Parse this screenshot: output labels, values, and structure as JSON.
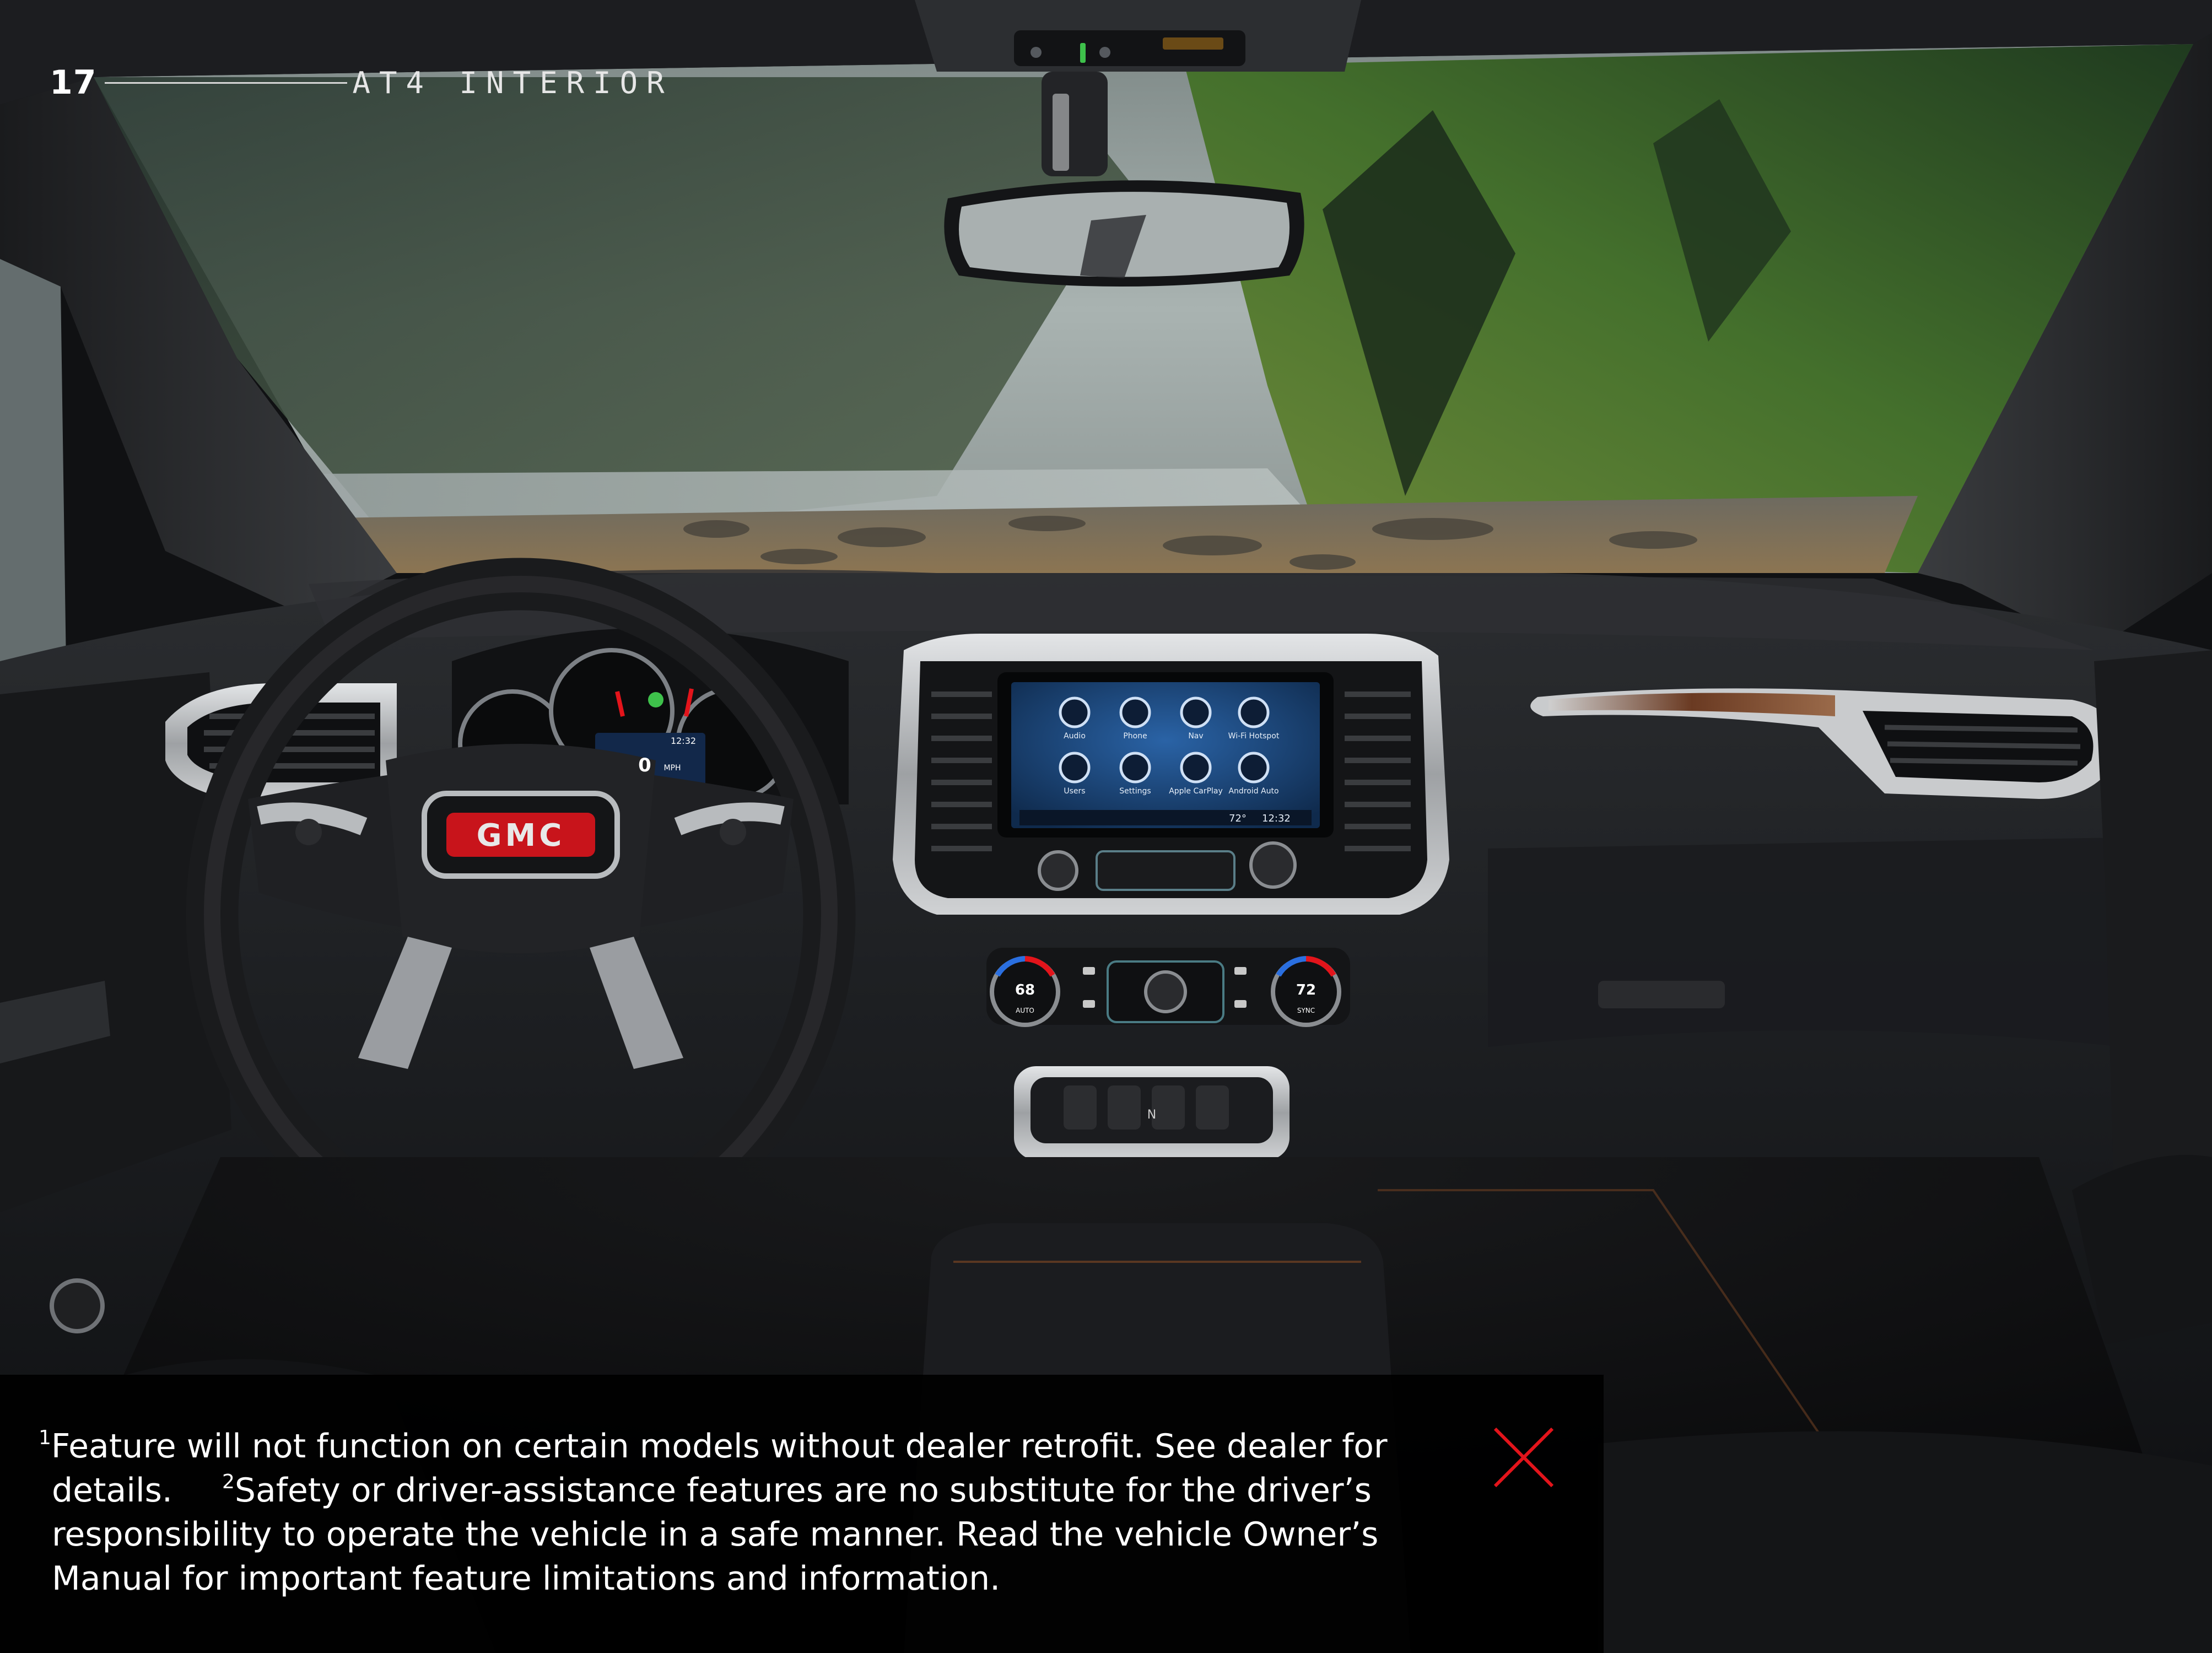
{
  "header": {
    "page_number": "17",
    "section_title": "AT4 INTERIOR"
  },
  "footnotes": {
    "note1_marker": "1",
    "note1_text": "Feature will not function on certain models without dealer retrofit. See dealer for details.",
    "note2_marker": "2",
    "note2_text": "Safety or driver-assistance features are no substitute for the driver’s responsibility to operate the vehicle in a safe manner. Read the vehicle Owner’s Manual for important feature limitations and information."
  },
  "close": {
    "icon": "close-icon",
    "color": "#e3141b"
  },
  "infotainment": {
    "apps": [
      "Audio",
      "Phone",
      "Nav",
      "Wi-Fi Hotspot",
      "Users",
      "Settings",
      "Apple CarPlay",
      "Android Auto"
    ],
    "status_time": "12:32",
    "status_temp": "72°"
  },
  "climate": {
    "left_temp": "68",
    "left_label": "AUTO",
    "right_temp": "72",
    "right_label": "SYNC"
  },
  "cluster": {
    "speed_value": "0",
    "speed_unit": "MPH",
    "time": "12:32"
  },
  "steering_wheel": {
    "badge": "GMC"
  },
  "gear_selector": {
    "gear": "N"
  },
  "colors": {
    "brand_red": "#c8141b",
    "accent_red": "#e3141b",
    "screen_blue": "#1c4e86",
    "trim_silver": "#b9bcbf"
  }
}
